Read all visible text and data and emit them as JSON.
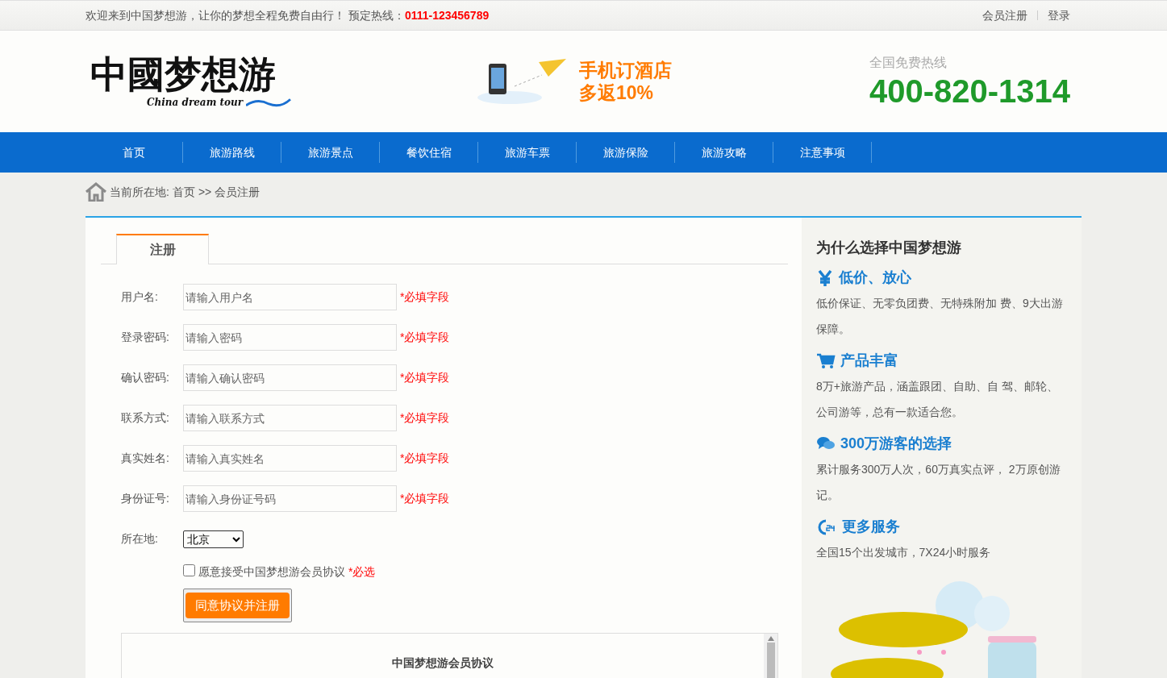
{
  "top_bar": {
    "welcome": "欢迎来到中国梦想游，让你的梦想全程免费自由行！ 预定热线：",
    "hotline": "0111-123456789",
    "links": [
      "会员注册",
      "登录"
    ]
  },
  "header": {
    "logo": {
      "text": "中國梦想游",
      "subtitle": "China dream tour"
    },
    "promo": {
      "line1": "手机订酒店",
      "line2": "多返10%"
    },
    "hotline": {
      "label": "全国免费热线",
      "number": "400-820-1314"
    }
  },
  "nav": [
    "首页",
    "旅游路线",
    "旅游景点",
    "餐饮住宿",
    "旅游车票",
    "旅游保险",
    "旅游攻略",
    "注意事项"
  ],
  "breadcrumb": {
    "label": "当前所在地:",
    "items": [
      "首页",
      "会员注册"
    ],
    "separator": ">>"
  },
  "form": {
    "tab": "注册",
    "fields": [
      {
        "label": "用户名:",
        "placeholder": "请输入用户名",
        "note": "*必填字段"
      },
      {
        "label": "登录密码:",
        "placeholder": "请输入密码",
        "note": "*必填字段"
      },
      {
        "label": "确认密码:",
        "placeholder": "请输入确认密码",
        "note": "*必填字段"
      },
      {
        "label": "联系方式:",
        "placeholder": "请输入联系方式",
        "note": "*必填字段"
      },
      {
        "label": "真实姓名:",
        "placeholder": "请输入真实姓名",
        "note": "*必填字段"
      },
      {
        "label": "身份证号:",
        "placeholder": "请输入身份证号码",
        "note": "*必填字段"
      }
    ],
    "location": {
      "label": "所在地:",
      "value": "北京"
    },
    "agreement": {
      "checked": false,
      "text": "愿意接受中国梦想游会员协议",
      "note": "*必选"
    },
    "submit": "同意协议并注册",
    "agreement_box": {
      "title": "中国梦想游会员协议"
    }
  },
  "sidebar": {
    "title": "为什么选择中国梦想游",
    "features": [
      {
        "title": "低价、放心",
        "text": "低价保证、无零负团费、无特殊附加 费、9大出游保障。"
      },
      {
        "title": "产品丰富",
        "text": "8万+旅游产品，涵盖跟团、自助、自 驾、邮轮、公司游等，总有一款适合您。"
      },
      {
        "title": "300万游客的选择",
        "text": "累计服务300万人次，60万真实点评， 2万原创游记。"
      },
      {
        "title": "更多服务",
        "text": "全国15个出发城市，7X24小时服务"
      }
    ]
  }
}
